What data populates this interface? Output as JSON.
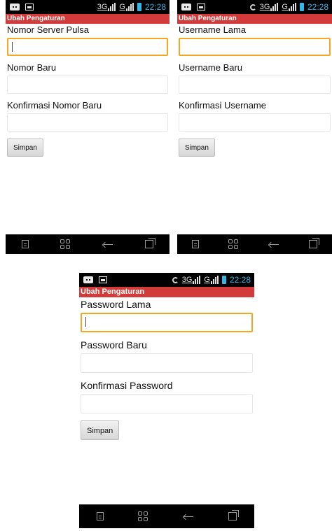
{
  "screens": [
    {
      "status": {
        "network_3g": "3G",
        "network_g": "G",
        "time": "22:28",
        "show_sync": false
      },
      "title": "Ubah Pengaturan",
      "fields": [
        {
          "label": "Nomor Server Pulsa",
          "value": "",
          "focused": true
        },
        {
          "label": "Nomor Baru",
          "value": "",
          "focused": false
        },
        {
          "label": "Konfirmasi Nomor Baru",
          "value": "",
          "focused": false
        }
      ],
      "button": "Simpan"
    },
    {
      "status": {
        "network_3g": "3G",
        "network_g": "G",
        "time": "22:28",
        "show_sync": true
      },
      "title": "Ubah Pengaturan",
      "fields": [
        {
          "label": "Username Lama",
          "value": "",
          "focused": true
        },
        {
          "label": "Username Baru",
          "value": "",
          "focused": false
        },
        {
          "label": "Konfirmasi Username",
          "value": "",
          "focused": false
        }
      ],
      "button": "Simpan"
    },
    {
      "status": {
        "network_3g": "3G",
        "network_g": "G",
        "time": "22:28",
        "show_sync": true
      },
      "title": "Ubah Pengaturan",
      "fields": [
        {
          "label": "Password Lama",
          "value": "",
          "focused": true
        },
        {
          "label": "Password Baru",
          "value": "",
          "focused": false
        },
        {
          "label": "Konfirmasi Password",
          "value": "",
          "focused": false
        }
      ],
      "button": "Simpan"
    }
  ],
  "icons": {
    "status_left": [
      "message-icon",
      "image-icon"
    ],
    "status_right": [
      "sync-icon",
      "signal-3g-icon",
      "signal-g-icon",
      "battery-icon"
    ],
    "nav": [
      "menu-icon",
      "apps-icon",
      "back-icon",
      "recent-apps-icon"
    ]
  },
  "colors": {
    "title_bar": "#d33b3b",
    "accent": "#33b5e5",
    "focus_border": "#f5a623"
  }
}
